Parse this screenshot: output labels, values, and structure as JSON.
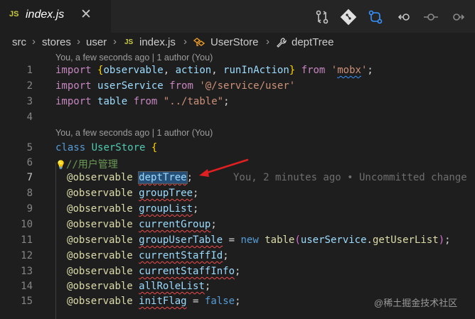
{
  "tab": {
    "icon_label": "JS",
    "filename": "index.js"
  },
  "toolbar": {
    "icons": [
      "open-changes-icon",
      "git-icon",
      "compare-icon",
      "go-back-icon",
      "git-commit-icon",
      "go-forward-icon"
    ]
  },
  "breadcrumb": {
    "items": [
      "src",
      "stores",
      "user",
      "index.js",
      "UserStore",
      "deptTree"
    ],
    "js_label": "JS"
  },
  "codelens": [
    "You, a few seconds ago | 1 author (You)",
    "You, a few seconds ago | 1 author (You)"
  ],
  "line_numbers": [
    "1",
    "2",
    "3",
    "4",
    "5",
    "6",
    "7",
    "8",
    "9",
    "10",
    "11",
    "12",
    "13",
    "14",
    "15"
  ],
  "code": {
    "l1": {
      "import": "import",
      "brace_open": "{",
      "observable": "observable",
      "comma1": ", ",
      "action": "action",
      "comma2": ", ",
      "runInAction": "runInAction",
      "brace_close": "}",
      "from": "from",
      "q1": "'",
      "mobx": "mobx",
      "q2": "'",
      "semi": ";"
    },
    "l2": {
      "import": "import",
      "name": "userService",
      "from": "from",
      "str": "'@/service/user'"
    },
    "l3": {
      "import": "import",
      "name": "table",
      "from": "from",
      "str": "\"../table\"",
      "semi": ";"
    },
    "l5": {
      "class": "class",
      "name": "UserStore",
      "brace": "{"
    },
    "l6": {
      "lightbulb": "💡",
      "comment": "//用户管理"
    },
    "l7": {
      "at": "@",
      "deco": "observable",
      "prop": "deptTree",
      "semi": ";"
    },
    "l8": {
      "at": "@",
      "deco": "observable",
      "prop": "groupTree",
      "semi": ";"
    },
    "l9": {
      "at": "@",
      "deco": "observable",
      "prop": "groupList",
      "semi": ";"
    },
    "l10": {
      "at": "@",
      "deco": "observable",
      "prop": "currentGroup",
      "semi": ";"
    },
    "l11": {
      "at": "@",
      "deco": "observable",
      "prop": "groupUserTable",
      "eq": " = ",
      "new": "new",
      "fn": "table",
      "paren_open": "(",
      "obj": "userService",
      "dot": ".",
      "method": "getUserList",
      "paren_close": ")",
      "semi": ";"
    },
    "l12": {
      "at": "@",
      "deco": "observable",
      "prop": "currentStaffId",
      "semi": ";"
    },
    "l13": {
      "at": "@",
      "deco": "observable",
      "prop": "currentStaffInfo",
      "semi": ";"
    },
    "l14": {
      "at": "@",
      "deco": "observable",
      "prop": "allRoleList",
      "semi": ";"
    },
    "l15": {
      "at": "@",
      "deco": "observable",
      "prop": "initFlag",
      "eq": " = ",
      "val": "false",
      "semi": ";"
    }
  },
  "inline_blame": "You, 2 minutes ago • Uncommitted change",
  "watermark": "@稀土掘金技术社区",
  "colors": {
    "arrow": "#e02020",
    "accent": "#007acc"
  }
}
